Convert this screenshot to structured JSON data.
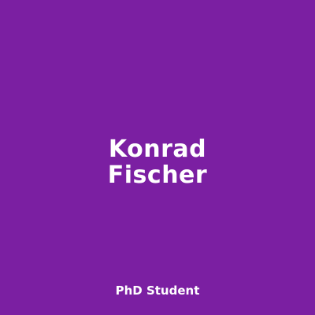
{
  "card": {
    "background_color": "#7b1fa2",
    "text_color": "#ffffff",
    "first_name": "Konrad",
    "last_name": "Fischer",
    "role": "PhD Student"
  }
}
